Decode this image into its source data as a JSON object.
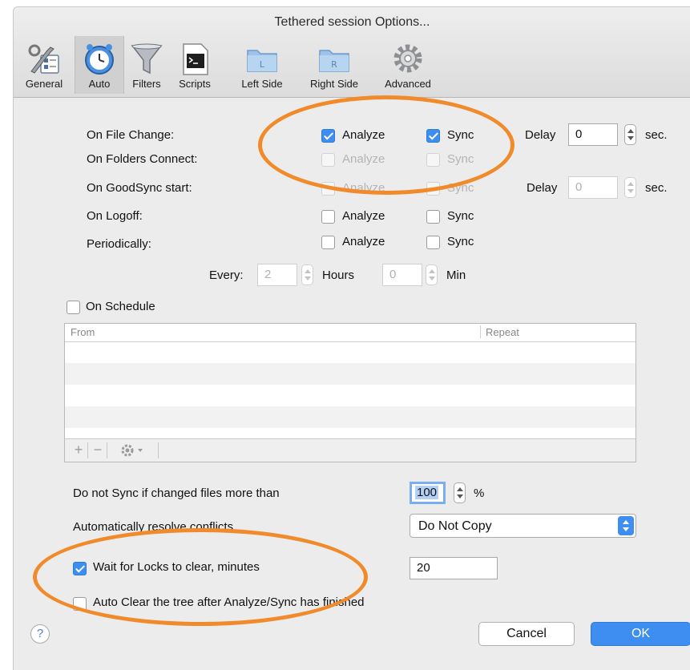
{
  "window": {
    "title": "Tethered session Options..."
  },
  "toolbar": {
    "items": [
      {
        "label": "General",
        "icon": "tools-icon"
      },
      {
        "label": "Auto",
        "icon": "clock-icon",
        "selected": true
      },
      {
        "label": "Filters",
        "icon": "filter-funnel-icon"
      },
      {
        "label": "Scripts",
        "icon": "terminal-icon"
      },
      {
        "label": "Left Side",
        "icon": "folder-left-icon",
        "badge": "L"
      },
      {
        "label": "Right Side",
        "icon": "folder-right-icon",
        "badge": "R"
      },
      {
        "label": "Advanced",
        "icon": "gear-icon"
      }
    ]
  },
  "triggers": {
    "analyze_label": "Analyze",
    "sync_label": "Sync",
    "delay_label": "Delay",
    "sec_label": "sec.",
    "rows": [
      {
        "label": "On File Change:",
        "analyze": true,
        "sync": true,
        "enabled": true,
        "delay": "0"
      },
      {
        "label": "On Folders Connect:",
        "analyze": false,
        "sync": false,
        "enabled": false
      },
      {
        "label": "On GoodSync start:",
        "analyze": false,
        "sync": false,
        "enabled": false,
        "delay": "0"
      },
      {
        "label": "On Logoff:",
        "analyze": false,
        "sync": false,
        "enabled": true
      },
      {
        "label": "Periodically:",
        "analyze": false,
        "sync": false,
        "enabled": true
      }
    ]
  },
  "periodic": {
    "every_label": "Every:",
    "hours_value": "2",
    "hours_label": "Hours",
    "min_value": "0",
    "min_label": "Min"
  },
  "schedule": {
    "checkbox_label": "On Schedule",
    "checked": false,
    "columns": [
      "From",
      "Repeat"
    ],
    "add_symbol": "+",
    "remove_symbol": "−"
  },
  "settings": {
    "max_changed_label": "Do not Sync if changed files more than",
    "max_changed_value": "100",
    "percent_label": "%",
    "conflicts_label": "Automatically resolve conflicts",
    "conflicts_value": "Do Not Copy",
    "wait_locks_label": "Wait for Locks to clear, minutes",
    "wait_locks_checked": true,
    "wait_locks_value": "20",
    "auto_clear_label": "Auto Clear the tree after Analyze/Sync has finished",
    "auto_clear_checked": false
  },
  "footer": {
    "help_label": "?",
    "cancel_label": "Cancel",
    "ok_label": "OK"
  },
  "colors": {
    "accent": "#3d8ef0",
    "highlight_circle": "#f08a2a"
  }
}
